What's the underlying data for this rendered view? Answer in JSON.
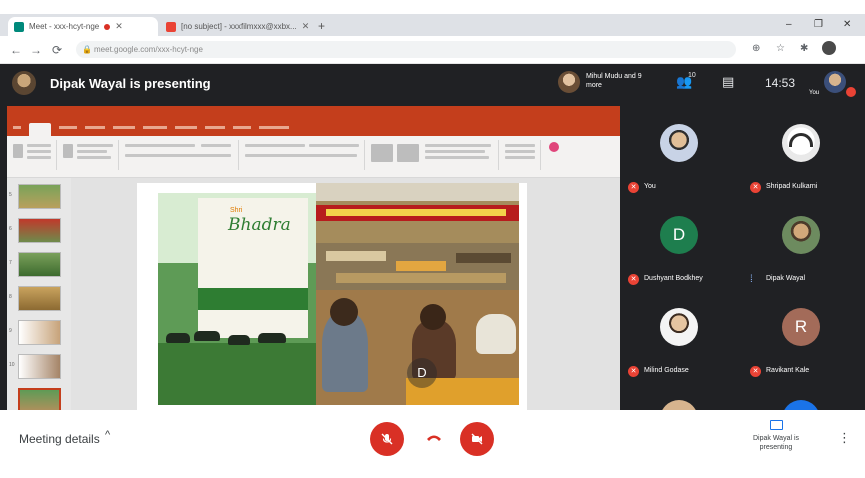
{
  "browser": {
    "tabs": [
      {
        "title": "Meet - xxx-hcyt-nge",
        "active": true
      },
      {
        "title": "[no subject] - xxxfilmxxx@xxbx...",
        "active": false
      }
    ],
    "new_tab": "+",
    "window_controls": {
      "minimize": "–",
      "maximize": "❐",
      "close": "✕"
    },
    "nav": {
      "back": "←",
      "forward": "→",
      "reload": "⟳"
    },
    "url": "meet.google.com/xxx-hcyt-nge",
    "ext_icons": [
      "⊕",
      "☆",
      "✱"
    ]
  },
  "meet_header": {
    "presenting_title": "Dipak Wayal is presenting",
    "pinned_name": "Mihul Mudu and 9 more",
    "people_count": "10",
    "clock": "14:53",
    "you_label": "You"
  },
  "slide": {
    "brand_name": "Bhadra",
    "brand_small": "Shri",
    "ghost_letter": "D"
  },
  "participants": [
    {
      "name": "You",
      "avatar": "photo",
      "muted": true
    },
    {
      "name": "Shripad Kulkarni",
      "avatar": "headset",
      "muted": true
    },
    {
      "name": "Dushyant Bodkhey",
      "avatar": "letter",
      "letter": "D",
      "muted": true
    },
    {
      "name": "Dipak Wayal",
      "avatar": "photo",
      "muted": false
    },
    {
      "name": "Milind Godase",
      "avatar": "photo",
      "muted": true
    },
    {
      "name": "Ravikant Kale",
      "avatar": "letter",
      "letter": "R",
      "muted": true
    }
  ],
  "bottom_bar": {
    "meeting_details": "Meeting details",
    "chevron": "^",
    "present_label": "Dipak Wayal is presenting",
    "more": "⋮"
  },
  "colors": {
    "meet_dark": "#202124",
    "danger": "#d93025",
    "ppt_accent": "#c43e1c",
    "link_blue": "#1a73e8"
  },
  "icons": {
    "mic": "mic-off-icon",
    "hangup": "call-end-icon",
    "camera": "camera-off-icon",
    "people": "people-icon",
    "chat": "chat-icon"
  }
}
